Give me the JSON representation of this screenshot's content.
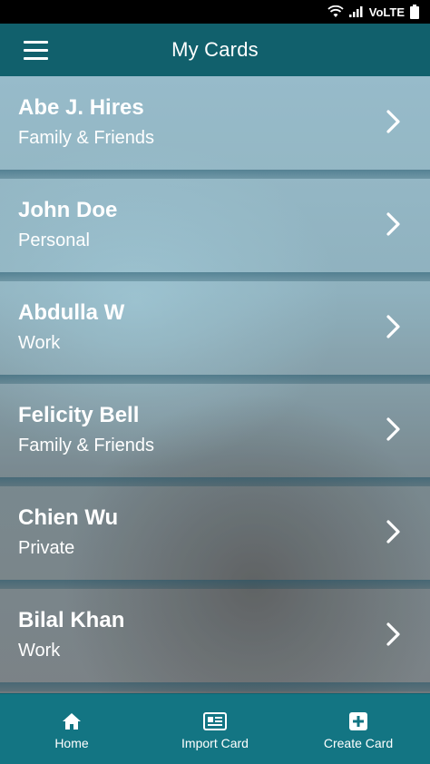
{
  "status_bar": {
    "network_label": "VoLTE"
  },
  "app_bar": {
    "title": "My Cards"
  },
  "cards": [
    {
      "name": "Abe J. Hires",
      "category": "Family & Friends"
    },
    {
      "name": "John Doe",
      "category": "Personal"
    },
    {
      "name": "Abdulla W",
      "category": "Work"
    },
    {
      "name": "Felicity Bell",
      "category": "Family & Friends"
    },
    {
      "name": "Chien Wu",
      "category": "Private"
    },
    {
      "name": "Bilal Khan",
      "category": "Work"
    }
  ],
  "bottom_nav": {
    "items": [
      {
        "label": "Home",
        "icon": "home-icon"
      },
      {
        "label": "Import Card",
        "icon": "import-card-icon"
      },
      {
        "label": "Create Card",
        "icon": "plus-square-icon"
      }
    ]
  },
  "colors": {
    "app_bar": "#11606c",
    "bottom_nav": "#137583",
    "text": "#ffffff"
  }
}
